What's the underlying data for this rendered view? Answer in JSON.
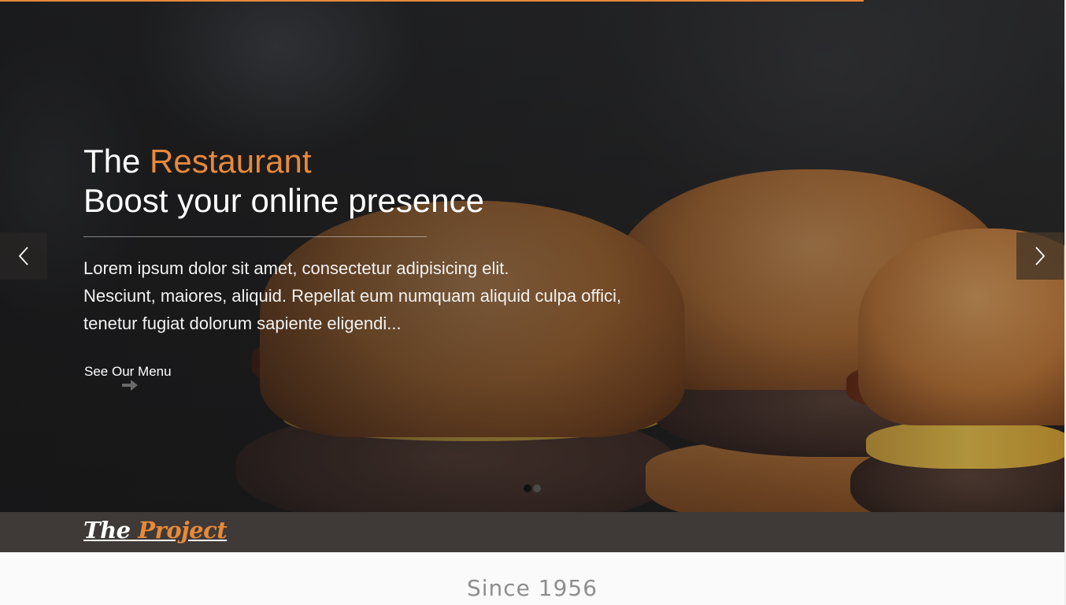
{
  "hero": {
    "title_prefix": "The",
    "title_accent": "Restaurant",
    "subtitle": "Boost your online presence",
    "description_lines": [
      "Lorem ipsum dolor sit amet, consectetur adipisicing elit.",
      "Nesciunt, maiores, aliquid. Repellat eum numquam aliquid culpa offici,",
      "tenetur fugiat dolorum sapiente eligendi..."
    ],
    "cta_label": "See Our Menu",
    "progress": 0.81
  },
  "slider": {
    "prev_icon": "chevron-left-icon",
    "next_icon": "chevron-right-icon",
    "slide_count": 2,
    "active_slide": 1
  },
  "navbar": {
    "logo_prefix": "The",
    "logo_accent": "Project"
  },
  "section": {
    "heading": "Since 1956"
  },
  "colors": {
    "accent": "#e8893a",
    "navbar": "#3f3a37",
    "background": "#fafafa"
  }
}
